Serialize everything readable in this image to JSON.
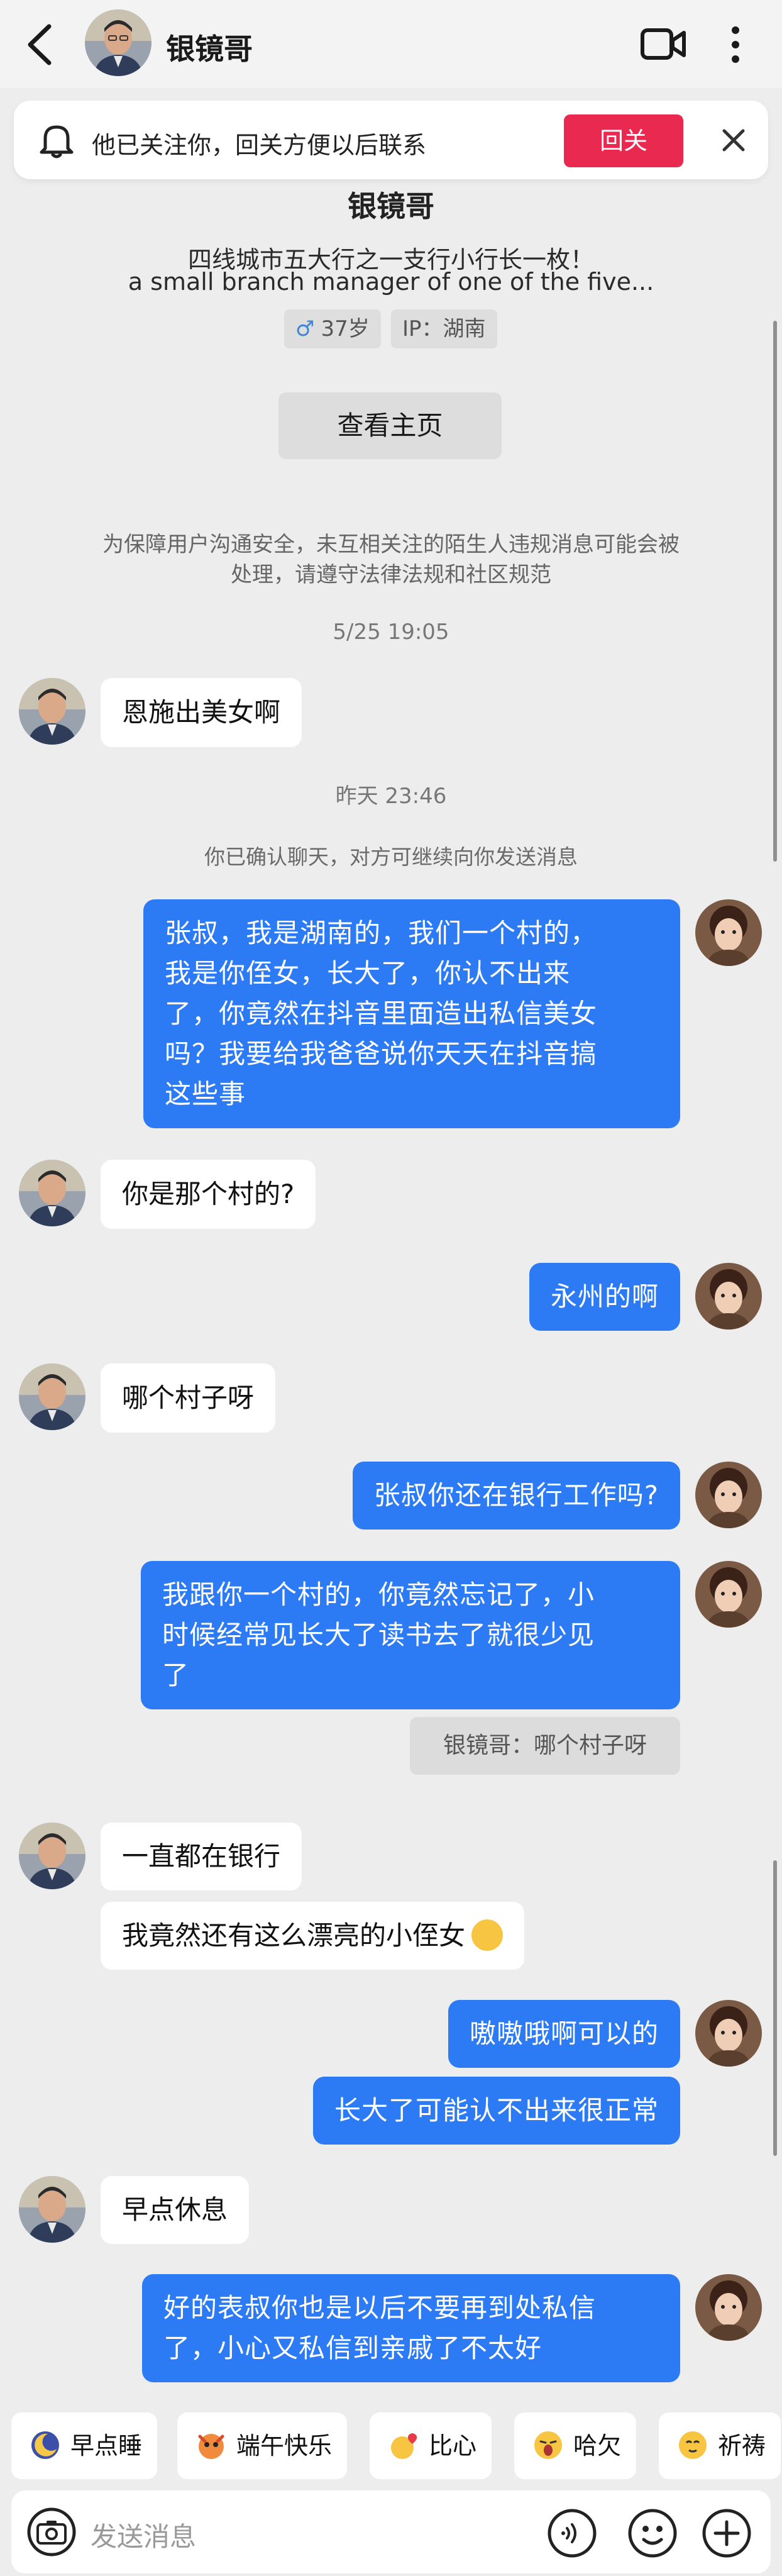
{
  "header": {
    "title": "银镜哥",
    "icons": [
      "back-icon",
      "video-call-icon",
      "more-icon"
    ]
  },
  "banner": {
    "text": "他已关注你，回关方便以后联系",
    "follow_label": "回关",
    "close": "×",
    "accent": "#ea2950"
  },
  "profile": {
    "name": "银镜哥",
    "bio_line1": "四线城市五大行之一支行小行长一枚！",
    "bio_line2": "a small branch  manager of one of the five...",
    "gender_symbol": "♂",
    "age": "37岁",
    "ip": "IP：湖南",
    "view_home": "查看主页"
  },
  "notice": {
    "line1": "为保障用户沟通安全，未互相关注的陌生人违规消息可能会被",
    "line2": "处理，请遵守法律法规和社区规范"
  },
  "chat": {
    "time1": "5/25 19:05",
    "time2": "昨天 23:46",
    "confirm": "你已确认聊天，对方可继续向你发送消息",
    "msgs": [
      {
        "side": "left",
        "text": "恩施出美女啊"
      },
      {
        "side": "right",
        "lines": [
          "张叔，我是湖南的，我们一个村的，",
          "我是你侄女，长大了，你认不出来",
          "了，你竟然在抖音里面造出私信美女",
          "吗？我要给我爸爸说你天天在抖音搞",
          "这些事"
        ]
      },
      {
        "side": "left",
        "text": "你是那个村的?"
      },
      {
        "side": "right",
        "text": "永州的啊"
      },
      {
        "side": "left",
        "text": "哪个村子呀"
      },
      {
        "side": "right",
        "text": "张叔你还在银行工作吗?"
      },
      {
        "side": "right",
        "lines": [
          "我跟你一个村的，你竟然忘记了，小",
          "时候经常见长大了读书去了就很少见",
          "了"
        ]
      },
      {
        "side": "left",
        "text": "一直都在银行"
      },
      {
        "side": "left",
        "text": "我竟然还有这么漂亮的小侄女"
      },
      {
        "side": "right",
        "text": "嗷嗷哦啊可以的"
      },
      {
        "side": "right",
        "text": "长大了可能认不出来很正常"
      },
      {
        "side": "left",
        "text": "早点休息"
      },
      {
        "side": "right",
        "lines": [
          "好的表叔你也是以后不要再到处私信",
          "了，小心又私信到亲戚了不太好"
        ]
      }
    ],
    "quote": "银镜哥：哪个村子呀",
    "bubble_color": "#2c7bf5"
  },
  "quick_replies": [
    {
      "label": "早点睡",
      "icon": "moon-icon"
    },
    {
      "label": "端午快乐",
      "icon": "dragon-icon"
    },
    {
      "label": "比心",
      "icon": "heart-hand-icon"
    },
    {
      "label": "哈欠",
      "icon": "yawn-icon"
    },
    {
      "label": "祈祷",
      "icon": "pray-icon"
    }
  ],
  "input": {
    "placeholder": "发送消息"
  }
}
